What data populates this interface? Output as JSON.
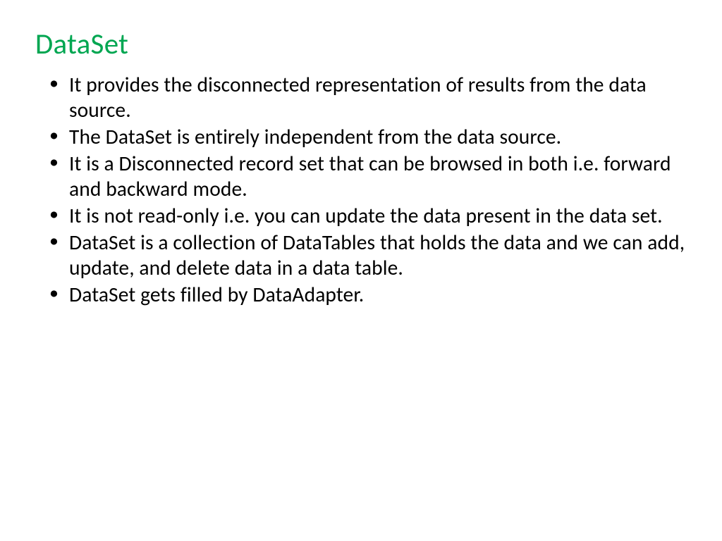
{
  "slide": {
    "title": "DataSet",
    "bullets": [
      "It provides the disconnected representation of results from the data source.",
      "The DataSet is entirely independent from the data source.",
      "It is a Disconnected record set that can be browsed in both i.e. forward and backward mode.",
      "It is not read-only i.e. you can update the data present in the data set.",
      "DataSet is a collection of DataTables that holds the data and we can add, update, and delete data in a data table.",
      "DataSet gets filled by DataAdapter."
    ]
  }
}
